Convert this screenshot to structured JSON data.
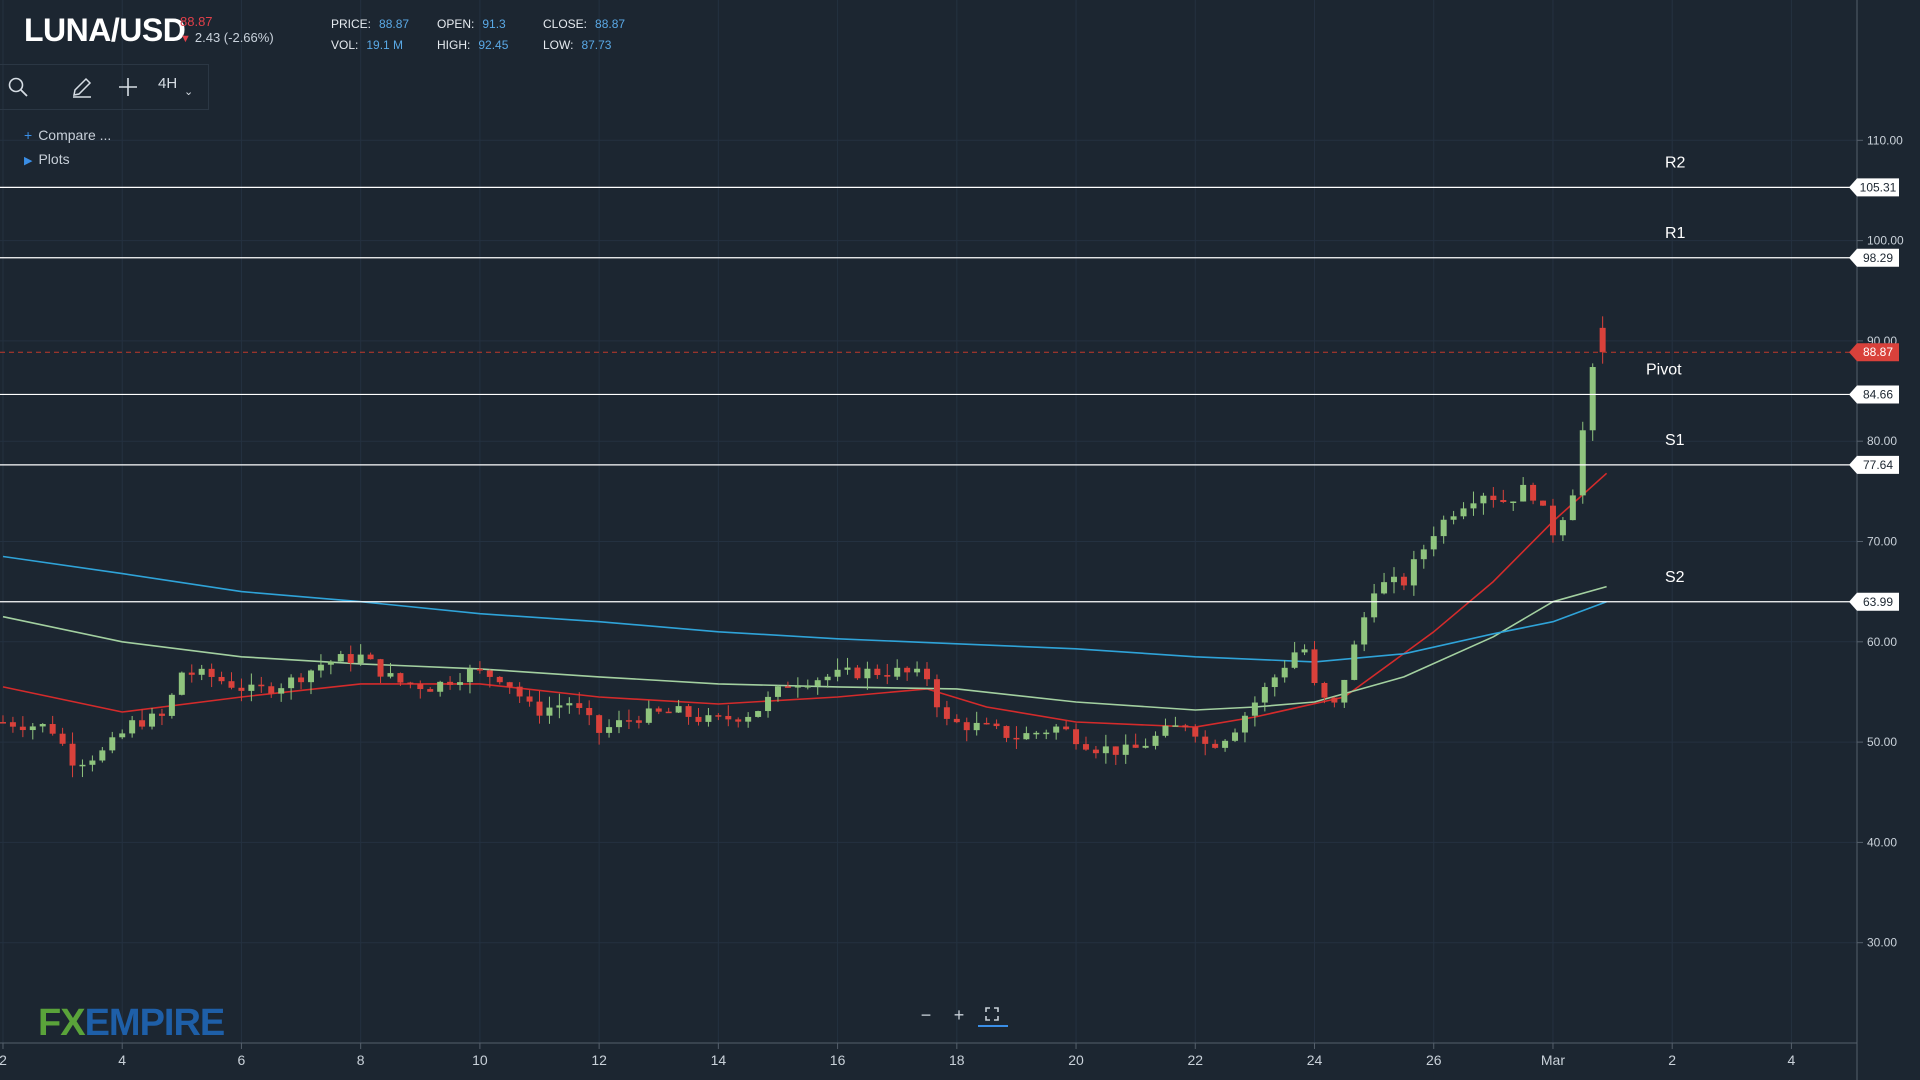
{
  "header": {
    "symbol": "LUNA/USD",
    "price_small": "88.87",
    "change": "2.43 (-2.66%)",
    "stats": [
      {
        "key": "PRICE:",
        "value": "88.87"
      },
      {
        "key": "OPEN:",
        "value": "91.3"
      },
      {
        "key": "CLOSE:",
        "value": "88.87"
      },
      {
        "key": "VOL:",
        "value": "19.1 M"
      },
      {
        "key": "HIGH:",
        "value": "92.45"
      },
      {
        "key": "LOW:",
        "value": "87.73"
      }
    ]
  },
  "toolbar": {
    "search_icon": "search-icon",
    "draw_icon": "pencil-icon",
    "crosshair_icon": "plus-icon",
    "timeframe": "4H"
  },
  "sidebar": {
    "compare_label": "Compare ...",
    "plots_label": "Plots"
  },
  "logo": {
    "fx": "FX",
    "empire": "EMPIRE"
  },
  "zoom": {
    "minus": "−",
    "plus": "+",
    "fullscreen_icon": "fullscreen-icon"
  },
  "colors": {
    "background": "#1c2631",
    "up": "#8fc47e",
    "down": "#d9413b",
    "ma_red": "#d42b2b",
    "ma_green": "#a3d0a0",
    "ma_blue": "#2fa3d8",
    "level_line": "#ffffff",
    "price_line": "#c0392b"
  },
  "chart_data": {
    "type": "candlestick",
    "ylim": [
      20,
      120
    ],
    "y_ticks": [
      "110.00",
      "100.00",
      "90.00",
      "80.00",
      "70.00",
      "60.00",
      "50.00",
      "40.00",
      "30.00"
    ],
    "y_tick_values": [
      110,
      100,
      90,
      80,
      70,
      60,
      50,
      40,
      30
    ],
    "x_ticks": [
      "2",
      "4",
      "6",
      "8",
      "10",
      "12",
      "14",
      "16",
      "18",
      "20",
      "22",
      "24",
      "26",
      "Mar",
      "2",
      "4"
    ],
    "x_tick_days": [
      2,
      4,
      6,
      8,
      10,
      12,
      14,
      16,
      18,
      20,
      22,
      24,
      26,
      28,
      30,
      32
    ],
    "xlim_days": [
      1.95,
      33.1
    ],
    "current_price": {
      "label": "88.87",
      "value": 88.87
    },
    "levels": [
      {
        "name": "R2",
        "value": 105.31,
        "label": "105.31"
      },
      {
        "name": "R1",
        "value": 98.29,
        "label": "98.29"
      },
      {
        "name": "Pivot",
        "value": 84.66,
        "label": "84.66"
      },
      {
        "name": "S1",
        "value": 77.64,
        "label": "77.64"
      },
      {
        "name": "S2",
        "value": 63.99,
        "label": "63.99"
      }
    ],
    "closes_anchor": [
      [
        2.0,
        52
      ],
      [
        2.8,
        51.5
      ],
      [
        3.2,
        48
      ],
      [
        3.7,
        49
      ],
      [
        4.2,
        52
      ],
      [
        4.7,
        52.5
      ],
      [
        5.0,
        57
      ],
      [
        5.5,
        56.5
      ],
      [
        6.2,
        55
      ],
      [
        6.8,
        56
      ],
      [
        7.4,
        58
      ],
      [
        8.0,
        58.5
      ],
      [
        8.6,
        56
      ],
      [
        9.2,
        55.5
      ],
      [
        9.8,
        57
      ],
      [
        10.4,
        56.5
      ],
      [
        10.9,
        53
      ],
      [
        11.5,
        54
      ],
      [
        12.0,
        51
      ],
      [
        12.6,
        52.5
      ],
      [
        13.3,
        53
      ],
      [
        13.9,
        52
      ],
      [
        14.6,
        53
      ],
      [
        15.2,
        56
      ],
      [
        15.8,
        56.5
      ],
      [
        16.4,
        57
      ],
      [
        17.0,
        57
      ],
      [
        17.5,
        56.5
      ],
      [
        17.8,
        52
      ],
      [
        18.4,
        51.5
      ],
      [
        19.0,
        50.5
      ],
      [
        19.7,
        51.5
      ],
      [
        20.3,
        49.5
      ],
      [
        20.9,
        49
      ],
      [
        21.5,
        51
      ],
      [
        21.9,
        52
      ],
      [
        22.2,
        49.5
      ],
      [
        22.6,
        51
      ],
      [
        23.0,
        54
      ],
      [
        23.4,
        57
      ],
      [
        23.8,
        60
      ],
      [
        24.0,
        55.5
      ],
      [
        24.3,
        53
      ],
      [
        24.7,
        60
      ],
      [
        25.0,
        65.5
      ],
      [
        25.5,
        66
      ],
      [
        26.0,
        71
      ],
      [
        26.4,
        73.5
      ],
      [
        26.8,
        75
      ],
      [
        27.2,
        74
      ],
      [
        27.6,
        75.5
      ],
      [
        28.0,
        71
      ],
      [
        28.3,
        74
      ],
      [
        28.6,
        84.5
      ],
      [
        28.8,
        91.3
      ],
      [
        28.95,
        88.87
      ]
    ],
    "series": [
      {
        "name": "",
        "values": [
          [
            2.0,
            55.5
          ],
          [
            4.0,
            53.0
          ],
          [
            6.0,
            54.5
          ],
          [
            8.0,
            55.8
          ],
          [
            10.0,
            55.8
          ],
          [
            12.0,
            54.5
          ],
          [
            14.0,
            53.8
          ],
          [
            16.0,
            54.5
          ],
          [
            17.5,
            55.3
          ],
          [
            18.5,
            53.5
          ],
          [
            20.0,
            52.0
          ],
          [
            22.0,
            51.5
          ],
          [
            23.0,
            52.5
          ],
          [
            24.5,
            54.5
          ],
          [
            26.0,
            61.0
          ],
          [
            27.0,
            66.0
          ],
          [
            28.0,
            72.0
          ],
          [
            28.9,
            76.8
          ]
        ]
      },
      {
        "name": "",
        "values": [
          [
            2.0,
            62.5
          ],
          [
            4.0,
            60.0
          ],
          [
            6.0,
            58.5
          ],
          [
            8.0,
            57.8
          ],
          [
            10.0,
            57.3
          ],
          [
            12.0,
            56.5
          ],
          [
            14.0,
            55.8
          ],
          [
            16.0,
            55.5
          ],
          [
            18.0,
            55.3
          ],
          [
            20.0,
            54.0
          ],
          [
            22.0,
            53.2
          ],
          [
            23.0,
            53.5
          ],
          [
            24.0,
            54.0
          ],
          [
            25.5,
            56.5
          ],
          [
            27.0,
            60.5
          ],
          [
            28.0,
            64.0
          ],
          [
            28.9,
            65.5
          ]
        ]
      },
      {
        "name": "",
        "values": [
          [
            2.0,
            68.5
          ],
          [
            4.0,
            66.8
          ],
          [
            6.0,
            65.0
          ],
          [
            8.0,
            64.0
          ],
          [
            10.0,
            62.8
          ],
          [
            12.0,
            62.0
          ],
          [
            14.0,
            61.0
          ],
          [
            16.0,
            60.3
          ],
          [
            18.0,
            59.8
          ],
          [
            20.0,
            59.3
          ],
          [
            22.0,
            58.5
          ],
          [
            24.0,
            58.0
          ],
          [
            25.5,
            58.8
          ],
          [
            27.0,
            60.8
          ],
          [
            28.0,
            62.0
          ],
          [
            28.9,
            64.0
          ]
        ]
      }
    ]
  }
}
